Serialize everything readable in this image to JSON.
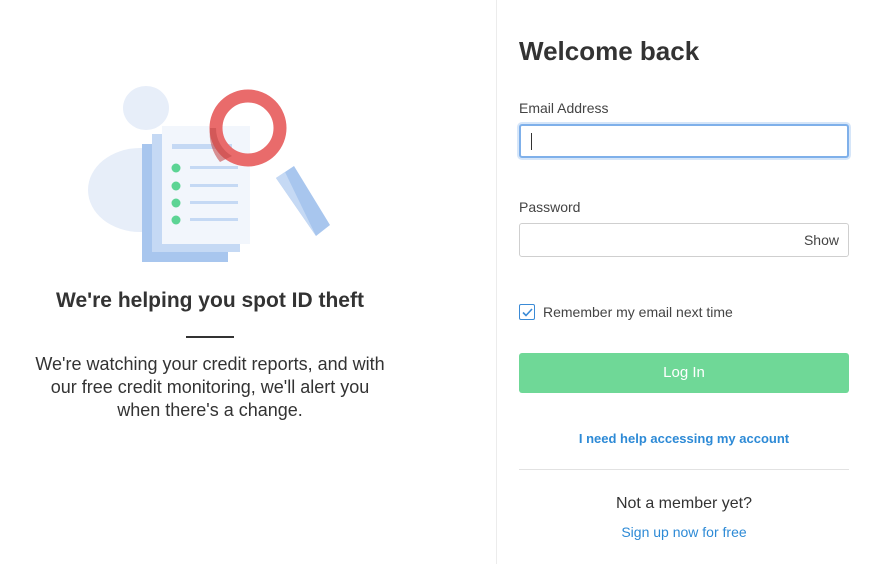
{
  "promo": {
    "heading": "We're helping you spot ID theft",
    "body_lines": [
      "We're watching your credit reports, and with",
      "our free credit monitoring, we'll alert you",
      "when there's a change."
    ]
  },
  "login": {
    "title": "Welcome back",
    "email_label": "Email Address",
    "email_value": "",
    "password_label": "Password",
    "password_value": "",
    "show_label": "Show",
    "remember_label": "Remember my email next time",
    "remember_checked": true,
    "login_label": "Log In",
    "help_link": "I need help accessing my account",
    "not_member": "Not a member yet?",
    "signup_link": "Sign up now for free"
  },
  "colors": {
    "accent_blue": "#2d8ad6",
    "login_green": "#6fd897",
    "magnifier_red": "#e96b6b"
  },
  "icons": {
    "illustration": "document-magnifier-illustration",
    "checkbox": "checkmark-icon"
  }
}
